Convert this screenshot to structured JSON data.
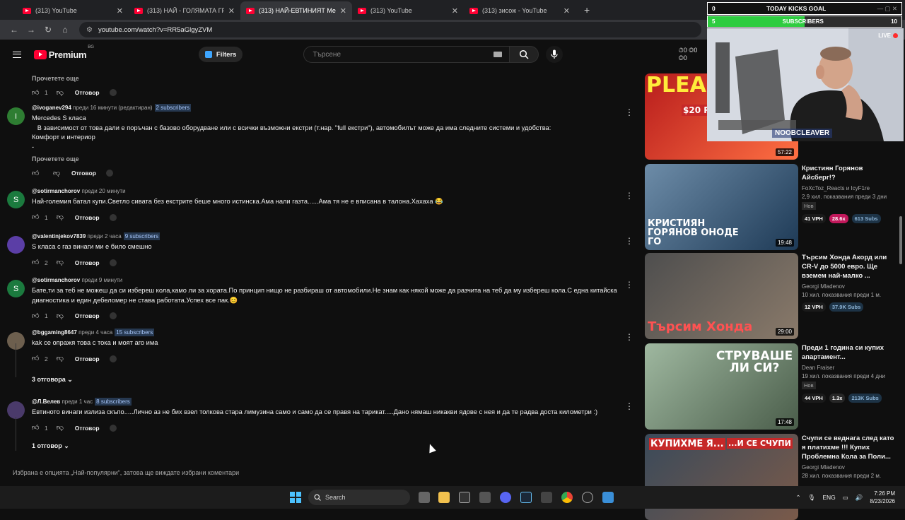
{
  "browser": {
    "tabs": [
      {
        "title": "(313) YouTube",
        "active": false
      },
      {
        "title": "(313) НАЙ - ГОЛЯМАТА ГРЕШК",
        "active": false
      },
      {
        "title": "(313) НАЙ-ЕВТИНИЯТ Мер",
        "active": true
      },
      {
        "title": "(313) YouTube",
        "active": false
      },
      {
        "title": "(313) зисож - YouTube",
        "active": false
      }
    ],
    "new_tab": "+",
    "url": "youtube.com/watch?v=RR5aGlgyZVM"
  },
  "header": {
    "logo": "Premium",
    "country": "BG",
    "filters_label": "Filters",
    "search_placeholder": "Търсене",
    "stats": "⏱0 ◎0 ◎0"
  },
  "comments": [
    {
      "read_more": "Прочетете още",
      "likes": "1",
      "reply": "Отговор"
    },
    {
      "avatar_letter": "I",
      "avatar_color": "#2e7d32",
      "handle": "@ivoganev294",
      "time": "преди 16 минути (редактиран)",
      "subs": "2 subscribers",
      "text": "Mercedes S класа\n   В зависимост от това дали е поръчан с базово оборудване или с всички възможни екстри (т.нар. \"full екстри\"), автомобилът може да има следните системи и удобства:\nКомфорт и интериор\n-",
      "read_more": "Прочетете още",
      "likes": "",
      "reply": "Отговор"
    },
    {
      "avatar_letter": "S",
      "avatar_color": "#1b7a3e",
      "handle": "@sotirmanchorov",
      "time": "преди 20 минути",
      "subs": "",
      "text": "Най-големия батал купи.Светло сивата без екстрите беше много истинска.Ама нали газта......Ама тя не е вписана в талона.Хахаха 😂",
      "likes": "1",
      "reply": "Отговор"
    },
    {
      "avatar_letter": "",
      "avatar_color": "#5b3ea6",
      "handle": "@valentinjekov7839",
      "time": "преди 2 часа",
      "subs": "9 subscribers",
      "text": "S класа с газ винаги ми е било смешно",
      "likes": "2",
      "reply": "Отговор"
    },
    {
      "avatar_letter": "S",
      "avatar_color": "#1b7a3e",
      "handle": "@sotirmanchorov",
      "time": "преди 9 минути",
      "subs": "",
      "text": "Бате,ти за теб не можеш да си избереш кола,камо ли за хората.По принцип нищо не разбираш от автомобили.Не знам как някой може да разчита на теб да му избереш кола.С една китайска диагностика и един дебеломер не става работата.Успех все пак.😊",
      "likes": "1",
      "reply": "Отговор"
    },
    {
      "avatar_letter": "",
      "avatar_color": "#6d5f4e",
      "handle": "@bggaming8647",
      "time": "преди 4 часа",
      "subs": "15 subscribers",
      "text": "kak се опражя това с тока и моят аго има",
      "likes": "2",
      "reply": "Отговор",
      "replies_label": "3 отговора"
    },
    {
      "avatar_letter": "",
      "avatar_color": "#4a3a6a",
      "handle": "@Л.Велев",
      "time": "преди 1 час",
      "subs": "8 subscribers",
      "text": "Евтиното винаги излиза скъпо.....Лично аз не бих взел толкова стара лимузина само и само да се правя на тарикат.....Дано нямаш никакви ядове с нея и да те радва доста километри :)",
      "likes": "1",
      "reply": "Отговор",
      "replies_label": "1 отговор"
    }
  ],
  "footnote": "Избрана е опцията „Най-популярни“, затова ще виждате избрани коментари",
  "sidebar": [
    {
      "thumb_text": "PLEAS",
      "thumb_sub": "$20 PA",
      "duration": "57:22",
      "title": "",
      "channel": "",
      "stats": ""
    },
    {
      "thumb_text": "КРИСТИЯН ГОРЯНОВ ОНОДЕ ГО",
      "duration": "19:48",
      "title": "Кристиян Горянов Айсберг!?",
      "channel": "FoXcToz_Reacts и IcyF1re",
      "stats": "2,9 хил. показвания преди 3 дни",
      "badge": "Нов",
      "vph": "41 VPH",
      "mult": "28.6x",
      "subs": "613 Subs"
    },
    {
      "thumb_text": "Търсим Хонда",
      "duration": "29:00",
      "title": "Търсим Хонда Акорд или CR-V до 5000 евро. Ще вземем най-малко ...",
      "channel": "Georgi Mladenov",
      "stats": "10 хил. показвания преди 1 м.",
      "vph": "12 VPH",
      "subs": "37.9K Subs"
    },
    {
      "thumb_text": "СТРУВАШЕ ЛИ СИ?",
      "duration": "17:48",
      "title": "Преди 1 година си купих апартамент...",
      "channel": "Dean Fraiser",
      "stats": "19 хил. показвания преди 4 дни",
      "badge": "Нов",
      "vph": "44 VPH",
      "mult": "1.3x",
      "subs": "213K Subs"
    },
    {
      "thumb_text": "КУПИХМЕ Я...",
      "thumb_sub": "...И СЕ СЧУПИ",
      "duration": "",
      "title": "Счупи се веднага след като я платихме !!! Купих Проблемна Кола за Поли...",
      "channel": "Georgi Mladenov",
      "stats": "28 хил. показвания преди 2 м."
    }
  ],
  "overlay": {
    "goal_left": "0",
    "goal_title": "TODAY KICKS GOAL",
    "subs_left": "5",
    "subs_title": "SUBSCRIBERS",
    "subs_right": "10",
    "subs_fraction": 0.5,
    "live": "LIVE",
    "brand": "NOOBCLEAVER"
  },
  "taskbar": {
    "search": "Search",
    "lang": "ENG",
    "time": "7:26 PM",
    "date": "8/23/2026"
  }
}
